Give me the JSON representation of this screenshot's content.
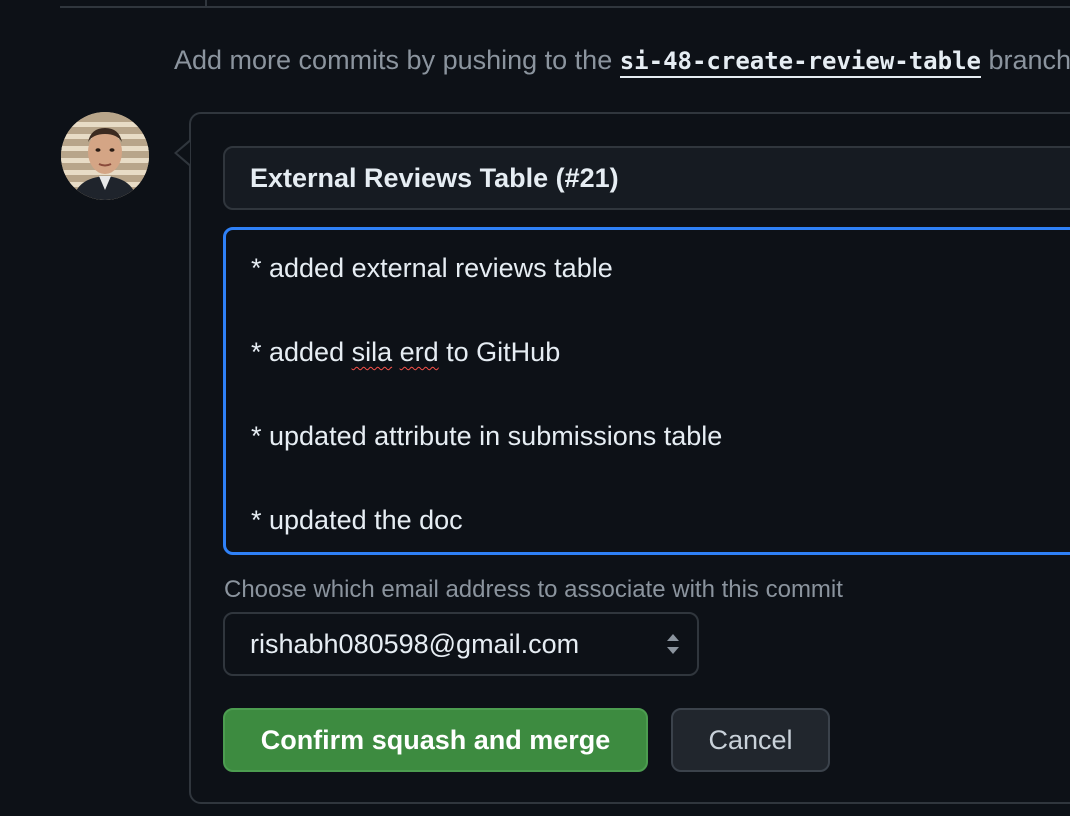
{
  "merge_hint": {
    "prefix": "Add more commits by pushing to the",
    "branch": "si-48-create-review-table",
    "suffix": "branch."
  },
  "commit": {
    "title_value": "External Reviews Table (#21)",
    "message_lines": [
      "* added external reviews table",
      "* added sila erd to GitHub",
      "* updated attribute in submissions table",
      "* updated the doc"
    ]
  },
  "email": {
    "label": "Choose which email address to associate with this commit",
    "selected": "rishabh080598@gmail.com"
  },
  "actions": {
    "confirm_label": "Confirm squash and merge",
    "cancel_label": "Cancel"
  },
  "colors": {
    "background": "#0d1117",
    "focus_border": "#2f81f7",
    "confirm_button": "#3d8b40",
    "spellcheck": "#f85149"
  },
  "icons": {
    "select": "select-arrows-icon"
  }
}
